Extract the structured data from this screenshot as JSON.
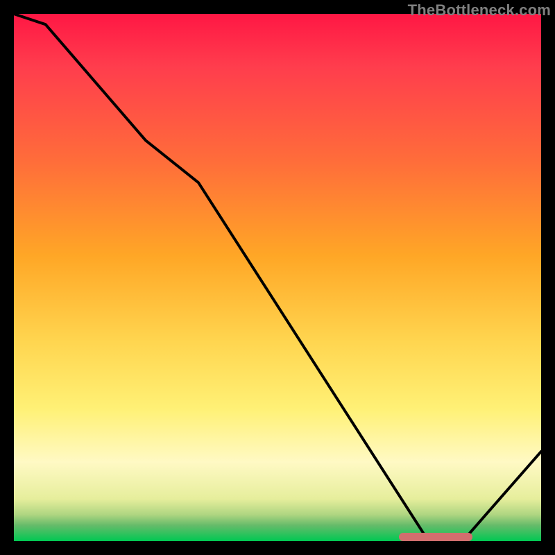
{
  "watermark": "TheBottleneck.com",
  "chart_data": {
    "type": "line",
    "title": "",
    "xlabel": "",
    "ylabel": "",
    "xlim": [
      0,
      100
    ],
    "ylim": [
      0,
      100
    ],
    "grid": false,
    "series": [
      {
        "name": "bottleneck-curve",
        "x": [
          0,
          6,
          25,
          35,
          78,
          86,
          100
        ],
        "values": [
          100,
          98,
          76,
          68,
          1,
          1,
          17
        ]
      }
    ],
    "marker": {
      "name": "optimal-range",
      "x_start": 73,
      "x_end": 87,
      "y": 0.8
    },
    "background_gradient": {
      "stops": [
        {
          "pos": 0,
          "color": "#ff1744"
        },
        {
          "pos": 10,
          "color": "#ff3d4d"
        },
        {
          "pos": 28,
          "color": "#ff6d3a"
        },
        {
          "pos": 46,
          "color": "#ffa726"
        },
        {
          "pos": 62,
          "color": "#ffd54f"
        },
        {
          "pos": 75,
          "color": "#fff176"
        },
        {
          "pos": 85,
          "color": "#fff9c4"
        },
        {
          "pos": 92,
          "color": "#e6ee9c"
        },
        {
          "pos": 95,
          "color": "#aed581"
        },
        {
          "pos": 97,
          "color": "#66bb6a"
        },
        {
          "pos": 100,
          "color": "#00c853"
        }
      ]
    }
  }
}
